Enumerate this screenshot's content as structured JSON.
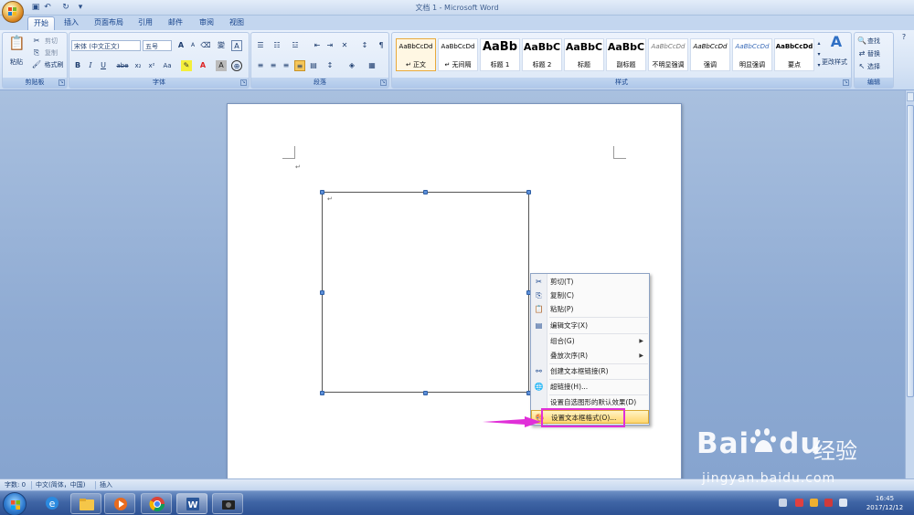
{
  "window": {
    "title": "文档 1 - Microsoft Word"
  },
  "tabs": [
    {
      "label": "开始",
      "active": true
    },
    {
      "label": "插入"
    },
    {
      "label": "页面布局"
    },
    {
      "label": "引用"
    },
    {
      "label": "邮件"
    },
    {
      "label": "审阅"
    },
    {
      "label": "视图"
    }
  ],
  "clipboard": {
    "paste": "粘贴",
    "cut": "剪切",
    "copy": "复制",
    "format_painter": "格式刷",
    "label": "剪贴板"
  },
  "font": {
    "name": "宋体 (中文正文)",
    "size": "五号",
    "label": "字体",
    "bold": "B",
    "italic": "I",
    "underline": "U",
    "strike": "abe",
    "subscript": "x₂",
    "superscript": "x²",
    "case": "Aa",
    "grow": "A",
    "shrink": "A",
    "clear": "A"
  },
  "paragraph": {
    "label": "段落"
  },
  "styles": {
    "label": "样式",
    "items": [
      {
        "sample": "AaBbCcDd",
        "name": "↵ 正文",
        "selected": true
      },
      {
        "sample": "AaBbCcDd",
        "name": "↵ 无间隔"
      },
      {
        "sample": "AaBb",
        "name": "标题 1"
      },
      {
        "sample": "AaBbC",
        "name": "标题 2"
      },
      {
        "sample": "AaBbC",
        "name": "标题"
      },
      {
        "sample": "AaBbC",
        "name": "副标题"
      },
      {
        "sample": "AaBbCcDd",
        "name": "不明显强调"
      },
      {
        "sample": "AaBbCcDd",
        "name": "强调"
      },
      {
        "sample": "AaBbCcDd",
        "name": "明显强调"
      },
      {
        "sample": "AaBbCcDd",
        "name": "要点"
      }
    ],
    "change_styles": "更改样式"
  },
  "editing": {
    "label": "编辑",
    "find": "查找",
    "replace": "替换",
    "select": "选择"
  },
  "context_menu": {
    "items": [
      {
        "label": "剪切(T)",
        "icon": "scissors-icon"
      },
      {
        "label": "复制(C)",
        "icon": "copy-icon"
      },
      {
        "label": "粘贴(P)",
        "icon": "paste-icon"
      },
      {
        "label": "编辑文字(X)",
        "icon": "edit-text-icon"
      },
      {
        "label": "组合(G)",
        "submenu": true
      },
      {
        "label": "叠放次序(R)",
        "submenu": true
      },
      {
        "label": "创建文本框链接(R)",
        "icon": "link-icon"
      },
      {
        "label": "超链接(H)...",
        "icon": "hyperlink-icon"
      },
      {
        "label": "设置自选图形的默认效果(D)"
      },
      {
        "label": "设置文本框格式(O)...",
        "icon": "format-icon",
        "highlighted": true
      }
    ]
  },
  "status": {
    "pages": "字数: 0",
    "language": "中文(简体，中国)",
    "mode": "插入"
  },
  "taskbar": {
    "time": "16:45",
    "date": "2017/12/12"
  },
  "watermark": {
    "brand": "Bai",
    "brand2": "du",
    "chinese": "经验",
    "url": "jingyan.baidu.com"
  },
  "colors": {
    "accent_highlight": "#e02fd8",
    "ribbon_blue": "#15428b",
    "menu_hover": "#ffd66e"
  }
}
